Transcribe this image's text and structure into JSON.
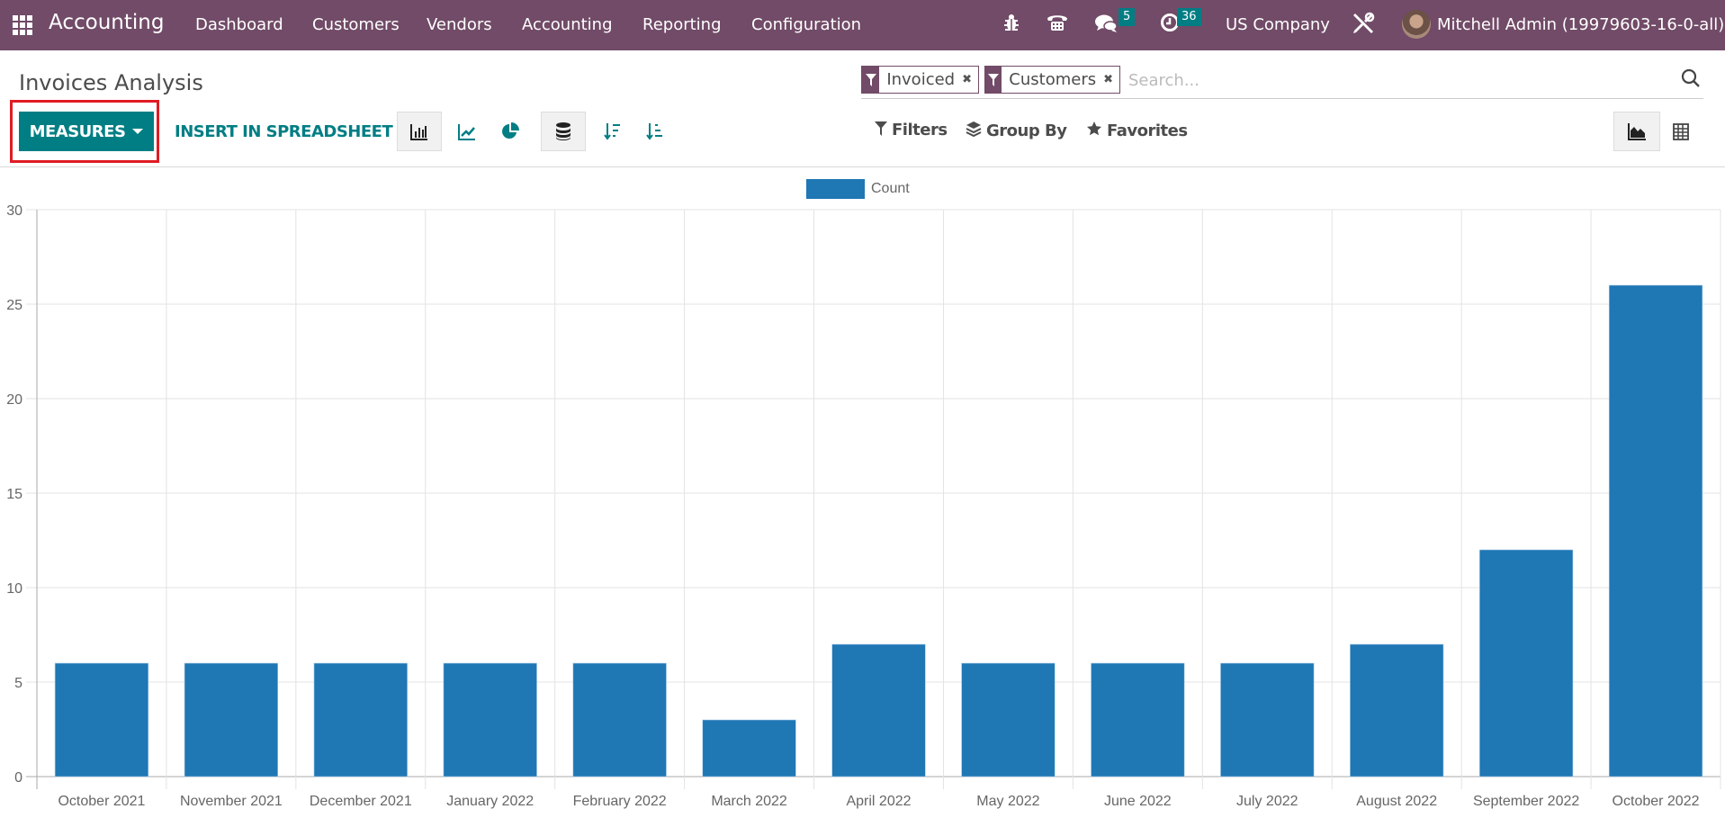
{
  "navbar": {
    "app_name": "Accounting",
    "menu": [
      "Dashboard",
      "Customers",
      "Vendors",
      "Accounting",
      "Reporting",
      "Configuration"
    ],
    "messages_badge": "5",
    "activities_badge": "36",
    "company": "US Company",
    "user": "Mitchell Admin (19979603-16-0-all)"
  },
  "page": {
    "title": "Invoices Analysis"
  },
  "search": {
    "facets": [
      {
        "label": "Invoiced",
        "icon": "filter-icon"
      },
      {
        "label": "Customers",
        "icon": "filter-icon"
      }
    ],
    "placeholder": "Search...",
    "options": {
      "filters": "Filters",
      "group_by": "Group By",
      "favorites": "Favorites"
    }
  },
  "toolbar": {
    "measures_label": "MEASURES",
    "insert_label": "INSERT IN SPREADSHEET",
    "chart_types": [
      "bar-chart",
      "line-chart",
      "pie-chart"
    ],
    "active_chart": "bar-chart",
    "stacked_active": true,
    "sort_options": [
      "descending",
      "ascending"
    ],
    "views": [
      "graph",
      "pivot"
    ],
    "active_view": "graph"
  },
  "colors": {
    "brand": "#714b67",
    "accent": "#017e84",
    "bar": "#1f77b4",
    "highlight": "#e01c24"
  },
  "chart_data": {
    "type": "bar",
    "title": "",
    "xlabel": "",
    "ylabel": "",
    "categories": [
      "October 2021",
      "November 2021",
      "December 2021",
      "January 2022",
      "February 2022",
      "March 2022",
      "April 2022",
      "May 2022",
      "June 2022",
      "July 2022",
      "August 2022",
      "September 2022",
      "October 2022"
    ],
    "series": [
      {
        "name": "Count",
        "values": [
          6,
          6,
          6,
          6,
          6,
          3,
          7,
          6,
          6,
          6,
          7,
          12,
          26
        ]
      }
    ],
    "ylim": [
      0,
      30
    ],
    "yticks": [
      0,
      5,
      10,
      15,
      20,
      25,
      30
    ],
    "grid": true,
    "legend": "top-center"
  }
}
